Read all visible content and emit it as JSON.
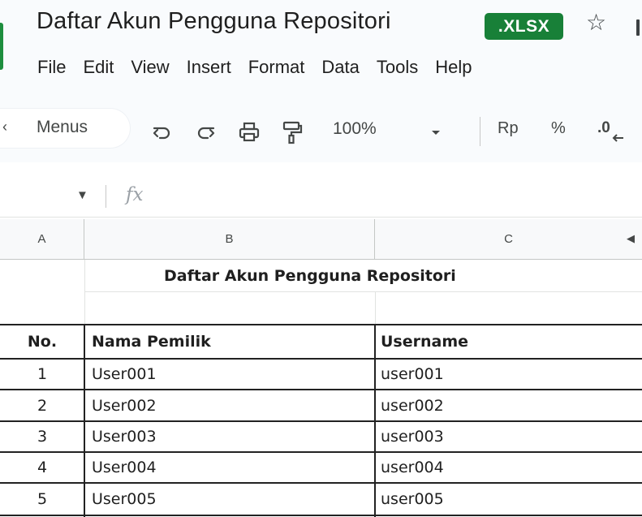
{
  "window": {
    "doc_title": "Daftar Akun Pengguna Repositori",
    "file_badge": ".XLSX",
    "star_icon": "star-outline-icon"
  },
  "menu": {
    "items": [
      "File",
      "Edit",
      "View",
      "Insert",
      "Format",
      "Data",
      "Tools",
      "Help"
    ]
  },
  "toolbar": {
    "menus_label": "Menus",
    "zoom": "100%",
    "currency": "Rp",
    "percent": "%",
    "decimal": ".0",
    "icons": [
      "undo-icon",
      "redo-icon",
      "print-icon",
      "paint-format-icon",
      "chevron-down-icon"
    ]
  },
  "formula_bar": {
    "fx": "fx"
  },
  "sheet": {
    "columns": [
      "A",
      "B",
      "C"
    ],
    "title": "Daftar Akun Pengguna Repositori",
    "headers": [
      "No.",
      "Nama Pemilik",
      "Username"
    ],
    "rows": [
      [
        "1",
        "User001",
        "user001"
      ],
      [
        "2",
        "User002",
        "user002"
      ],
      [
        "3",
        "User003",
        "user003"
      ],
      [
        "4",
        "User004",
        "user004"
      ],
      [
        "5",
        "User005",
        "user005"
      ]
    ]
  }
}
